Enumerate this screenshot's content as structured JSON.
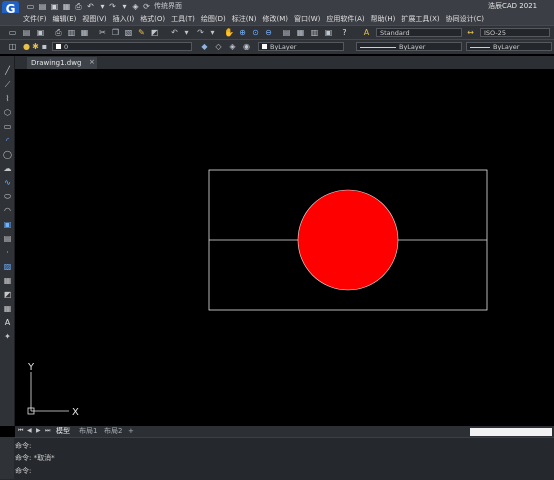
{
  "app": {
    "logo_letter": "G",
    "title": "浩辰CAD 2021",
    "workspace": "传统界面"
  },
  "menu": [
    {
      "id": "file",
      "label": "文件(F)"
    },
    {
      "id": "edit",
      "label": "编辑(E)"
    },
    {
      "id": "view",
      "label": "视图(V)"
    },
    {
      "id": "insert",
      "label": "插入(I)"
    },
    {
      "id": "format",
      "label": "格式(O)"
    },
    {
      "id": "tools",
      "label": "工具(T)"
    },
    {
      "id": "draw",
      "label": "绘图(D)"
    },
    {
      "id": "dim",
      "label": "标注(N)"
    },
    {
      "id": "modify",
      "label": "修改(M)"
    },
    {
      "id": "window",
      "label": "窗口(W)"
    },
    {
      "id": "apps",
      "label": "应用软件(A)"
    },
    {
      "id": "help",
      "label": "帮助(H)"
    },
    {
      "id": "ext",
      "label": "扩展工具(X)"
    },
    {
      "id": "collab",
      "label": "协同设计(C)"
    }
  ],
  "toolbar": {
    "text_style": "Standard",
    "dim_style": "ISO-25",
    "layer_name": "0",
    "color": "ByLayer",
    "linetype": "ByLayer",
    "lineweight": "ByLayer"
  },
  "document": {
    "tab_label": "Drawing1.dwg"
  },
  "layout_tabs": [
    {
      "id": "model",
      "label": "模型",
      "active": true
    },
    {
      "id": "layout1",
      "label": "布局1",
      "active": false
    },
    {
      "id": "layout2",
      "label": "布局2",
      "active": false
    },
    {
      "id": "add",
      "label": "+",
      "active": false
    }
  ],
  "ucs": {
    "x_label": "X",
    "y_label": "Y"
  },
  "command_lines": [
    "命令:",
    "命令: *取消*",
    "命令:"
  ],
  "colors": {
    "circle_fill": "#ff0000",
    "geometry": "#e6e6e6",
    "background": "#000000"
  }
}
